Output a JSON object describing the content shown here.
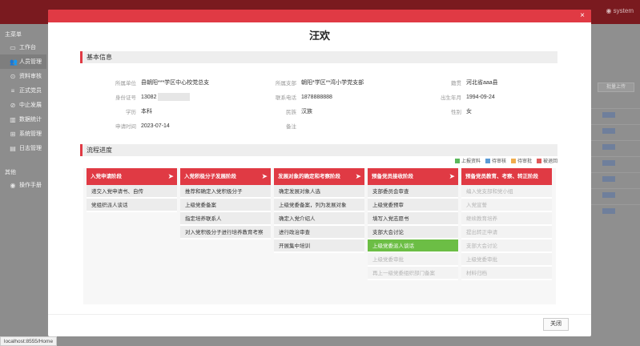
{
  "topbar": {
    "user": "system"
  },
  "sidebar": {
    "header": "主菜单",
    "items": [
      {
        "icon": "monitor-icon",
        "glyph": "▭",
        "label": "工作台"
      },
      {
        "icon": "users-icon",
        "glyph": "👥",
        "label": "人员管理"
      },
      {
        "icon": "review-icon",
        "glyph": "⊙",
        "label": "资料审核"
      },
      {
        "icon": "list-icon",
        "glyph": "≡",
        "label": "正式党员"
      },
      {
        "icon": "ban-icon",
        "glyph": "⊘",
        "label": "中止发展"
      },
      {
        "icon": "chart-icon",
        "glyph": "▥",
        "label": "数据统计"
      },
      {
        "icon": "grid-icon",
        "glyph": "⊞",
        "label": "系统管理"
      },
      {
        "icon": "log-icon",
        "glyph": "▤",
        "label": "日志管理"
      }
    ],
    "other_header": "其他",
    "other_items": [
      {
        "icon": "manual-icon",
        "glyph": "◉",
        "label": "操作手册"
      }
    ]
  },
  "background": {
    "upload_button": "批量上传"
  },
  "status_url": "localhost:8555/Home",
  "modal": {
    "title": "汪欢",
    "close_glyph": "×",
    "basic_section": "基本信息",
    "info": {
      "unit_label": "所属单位",
      "unit": "县朝阳***学区中心校党总支",
      "branch_label": "所属支部",
      "branch": "朝阳*学区**湾小学党支部",
      "origin_label": "籍贯",
      "origin": "河北省aaa县",
      "id_label": "身份证号",
      "id": "13082",
      "phone_label": "联系电话",
      "phone": "1878888888",
      "birth_label": "出生年月",
      "birth": "1994-09-24",
      "edu_label": "学历",
      "edu": "本科",
      "nation_label": "民族",
      "nation": "汉族",
      "gender_label": "性别",
      "gender": "女",
      "apply_label": "申请时间",
      "apply": "2023-07-14",
      "remark_label": "备注",
      "remark": ""
    },
    "flow_section": "流程进度",
    "legend": [
      {
        "label": "上报资料",
        "color": "#5cb85c"
      },
      {
        "label": "待审核",
        "color": "#5b9bd5"
      },
      {
        "label": "待审批",
        "color": "#f0ad4e"
      },
      {
        "label": "被退回",
        "color": "#e05a5a"
      }
    ],
    "stages": [
      {
        "title": "入党申请阶段",
        "steps": [
          "递交入党申请书、自传",
          "党组织派人谈话"
        ]
      },
      {
        "title": "入党积极分子发展阶段",
        "steps": [
          "推荐和确定入党积极分子",
          "上级党委备案",
          "指定培养联系人",
          "对入党积极分子进行培养教育考察"
        ]
      },
      {
        "title": "发展对象的确定和考察阶段",
        "steps": [
          "确定发展对象人选",
          "上级党委备案，列为发展对象",
          "确定入党介绍人",
          "进行政治审查",
          "开展集中培训"
        ]
      },
      {
        "title": "预备党员接收阶段",
        "steps": [
          "支部委员会审查",
          "上级党委预审",
          "填写入党志愿书",
          "支部大会讨论",
          "上级党委派人谈话",
          "上级党委审批",
          "再上一级党委组织部门备案"
        ]
      },
      {
        "title": "预备党员教育、考察、转正阶段",
        "steps": [
          "编入党支部和党小组",
          "入党宣誓",
          "继续教育培养",
          "提出转正申请",
          "支部大会讨论",
          "上级党委审批",
          "材料归档"
        ]
      }
    ],
    "close_button": "关闭"
  }
}
